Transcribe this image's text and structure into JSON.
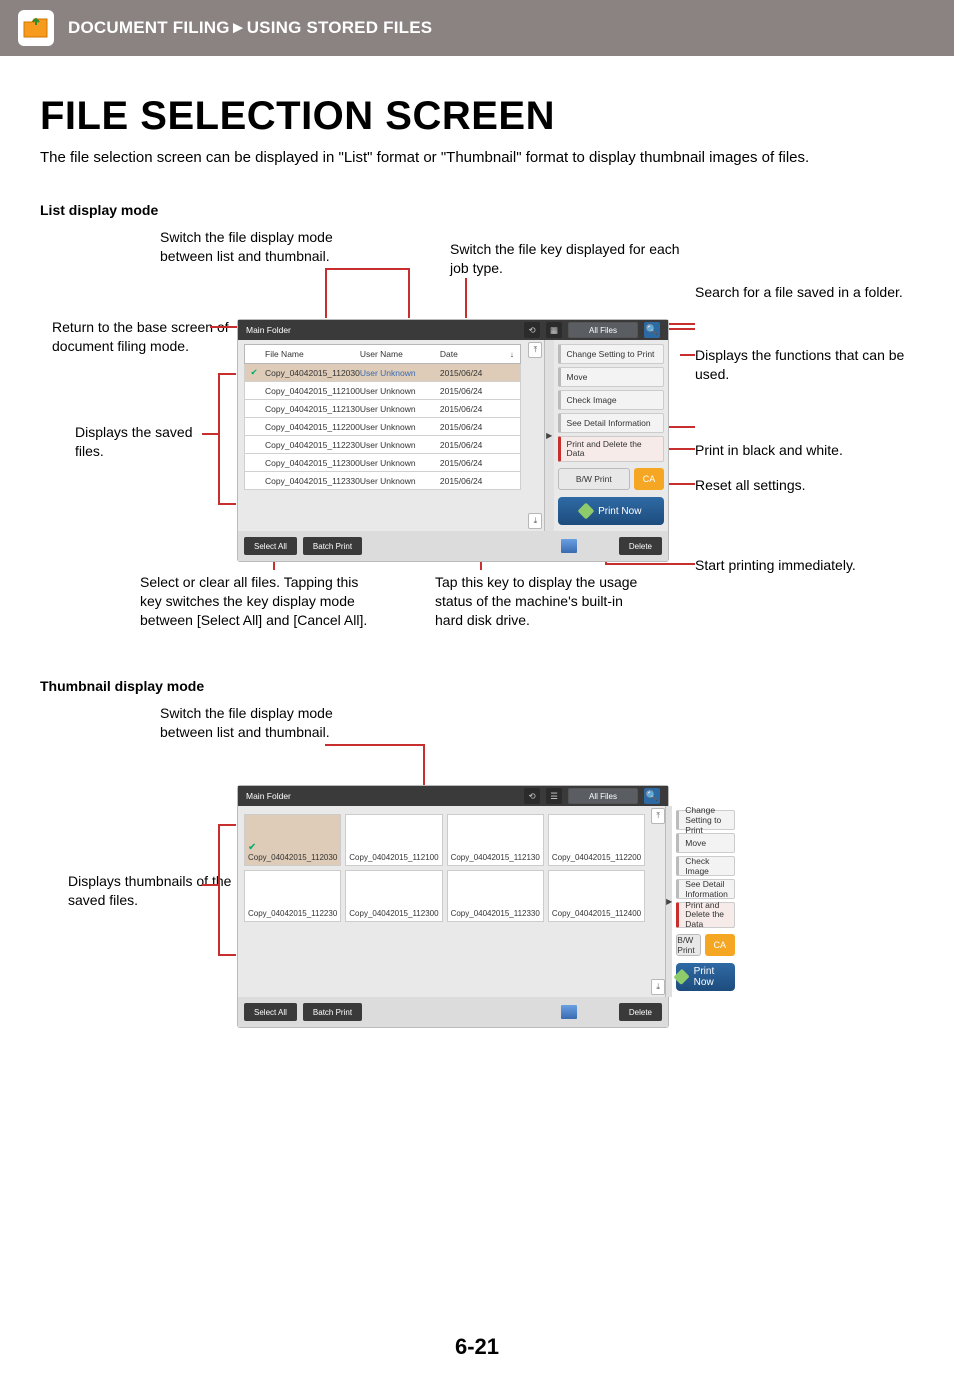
{
  "banner": {
    "breadcrumb1": "DOCUMENT FILING",
    "sep": "►",
    "breadcrumb2": "USING STORED FILES"
  },
  "title": "FILE SELECTION SCREEN",
  "intro": "The file selection screen can be displayed in \"List\" format or \"Thumbnail\" format to display thumbnail images of files.",
  "section1": "List display mode",
  "section2": "Thumbnail display mode",
  "callouts": {
    "switch_mode": "Switch the file display mode between list and thumbnail.",
    "job_type": "Switch the file key displayed for each job type.",
    "search": "Search for a file saved in a folder.",
    "return_base": "Return to the base screen of document filing mode.",
    "functions": "Displays the functions that can be used.",
    "saved_files": "Displays the saved files.",
    "bw_print": "Print in black and white.",
    "reset_all": "Reset all settings.",
    "start_print": "Start printing immediately.",
    "select_all_note": "Select or clear all files. Tapping this key switches the key display mode between [Select All] and [Cancel All].",
    "hdd_note": "Tap this key to display the usage status of the machine's built-in hard disk drive.",
    "thumbs_note": "Displays thumbnails of the saved files."
  },
  "panel": {
    "folder": "Main Folder",
    "all_files": "All Files",
    "cols": {
      "name": "File Name",
      "user": "User Name",
      "date": "Date"
    },
    "rows": [
      {
        "name": "Copy_04042015_112030",
        "user": "User Unknown",
        "date": "2015/06/24",
        "selected": true
      },
      {
        "name": "Copy_04042015_112100",
        "user": "User Unknown",
        "date": "2015/06/24"
      },
      {
        "name": "Copy_04042015_112130",
        "user": "User Unknown",
        "date": "2015/06/24"
      },
      {
        "name": "Copy_04042015_112200",
        "user": "User Unknown",
        "date": "2015/06/24"
      },
      {
        "name": "Copy_04042015_112230",
        "user": "User Unknown",
        "date": "2015/06/24"
      },
      {
        "name": "Copy_04042015_112300",
        "user": "User Unknown",
        "date": "2015/06/24"
      },
      {
        "name": "Copy_04042015_112330",
        "user": "User Unknown",
        "date": "2015/06/24"
      }
    ],
    "footer": {
      "select_all": "Select All",
      "batch": "Batch Print",
      "delete": "Delete"
    },
    "menu": {
      "m1": "Change Setting to Print",
      "m2": "Move",
      "m3": "Check Image",
      "m4": "See Detail Information",
      "m5": "Print and Delete the Data"
    },
    "bw": "B/W Print",
    "ca": "CA",
    "printnow": "Print Now"
  },
  "panel2_thumbs": [
    "Copy_04042015_112030",
    "Copy_04042015_112100",
    "Copy_04042015_112130",
    "Copy_04042015_112200",
    "Copy_04042015_112230",
    "Copy_04042015_112300",
    "Copy_04042015_112330",
    "Copy_04042015_112400"
  ],
  "page_number": "6-21"
}
